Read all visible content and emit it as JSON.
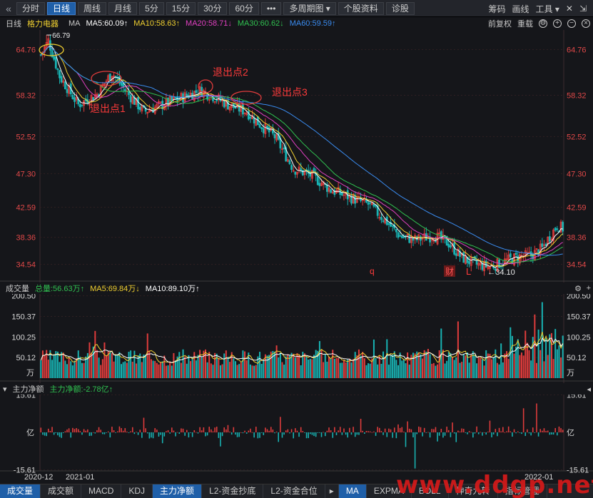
{
  "toolbar": {
    "back_icon": "double-chevron-left-icon",
    "buttons": [
      "分时",
      "日线",
      "周线",
      "月线",
      "5分",
      "15分",
      "30分",
      "60分"
    ],
    "active_index": 1,
    "more_label": "•••",
    "multi_period": "多周期图 ▾",
    "stock_info": "个股资料",
    "diagnose": "诊股",
    "right": [
      "筹码",
      "画线",
      "工具 ▾",
      "✕",
      "⇲"
    ]
  },
  "infobar": {
    "period": "日线",
    "stock_name": "格力电器",
    "indicator": "MA",
    "ma5": "MA5:60.09↑",
    "ma10": "MA10:58.63↑",
    "ma20": "MA20:58.71↓",
    "ma30": "MA30:60.62↓",
    "ma60": "MA60:59.59↑",
    "adjust": "前复权",
    "overlay": "重载"
  },
  "colors": {
    "up": "#e03c3c",
    "down": "#18b3b3",
    "ma5": "#ffffff",
    "ma10": "#f0d030",
    "ma20": "#e040c0",
    "ma30": "#30c050",
    "ma60": "#3a8cf0",
    "axis_red": "#e04848",
    "grid": "#2f1f22"
  },
  "volume_header": {
    "title": "成交量",
    "total": "总量:56.63万↑",
    "ma5": "MA5:69.84万↓",
    "ma10": "MA10:89.10万↑"
  },
  "flow_header": {
    "title": "主力净额",
    "value": "主力净额:-2.78亿↑"
  },
  "tabs": [
    "成交量",
    "成交额",
    "MACD",
    "KDJ",
    "主力净额",
    "L2-资金抄底",
    "L2-资金合位",
    "MA",
    "EXPMA",
    "BOLL",
    "神奇九转",
    "指标管理"
  ],
  "active_tabs": [
    0,
    4,
    7
  ],
  "watermark": "www.ddgp.net",
  "chart_data": [
    {
      "type": "candlestick",
      "y_ticks": [
        "64.76",
        "58.32",
        "52.52",
        "47.30",
        "42.59",
        "38.36",
        "34.54"
      ],
      "ylim": [
        32.5,
        67.5
      ],
      "high_marker": "66.79",
      "low_marker": "←34.10",
      "annotations": [
        "退出点1",
        "退出点2",
        "退出点3"
      ],
      "event_marks": [
        "q",
        "财",
        "L"
      ],
      "x_labels": [
        "2020-12",
        "2021-01",
        "2022-01"
      ],
      "trend_points": [
        [
          0,
          64.0
        ],
        [
          4,
          66.0
        ],
        [
          10,
          61.0
        ],
        [
          20,
          57.0
        ],
        [
          30,
          58.5
        ],
        [
          38,
          61.5
        ],
        [
          45,
          59.0
        ],
        [
          55,
          56.0
        ],
        [
          65,
          57.0
        ],
        [
          75,
          58.0
        ],
        [
          85,
          59.0
        ],
        [
          92,
          58.2
        ],
        [
          100,
          57.0
        ],
        [
          110,
          56.0
        ],
        [
          118,
          54.0
        ],
        [
          125,
          52.5
        ],
        [
          135,
          48.0
        ],
        [
          145,
          47.0
        ],
        [
          155,
          45.0
        ],
        [
          165,
          44.0
        ],
        [
          175,
          43.0
        ],
        [
          185,
          40.5
        ],
        [
          192,
          38.5
        ],
        [
          200,
          38.0
        ],
        [
          210,
          38.6
        ],
        [
          218,
          37.5
        ],
        [
          225,
          35.5
        ],
        [
          232,
          34.6
        ],
        [
          240,
          34.2
        ],
        [
          248,
          35.0
        ],
        [
          255,
          35.6
        ],
        [
          262,
          35.8
        ],
        [
          268,
          36.8
        ],
        [
          272,
          38.5
        ],
        [
          276,
          40.0
        ],
        [
          280,
          39.5
        ]
      ]
    },
    {
      "type": "bar",
      "name": "成交量",
      "y_ticks": [
        "200.50",
        "150.37",
        "100.25",
        "50.12"
      ],
      "unit": "万",
      "ylim": [
        0,
        205
      ]
    },
    {
      "type": "bar",
      "name": "主力净额",
      "y_ticks": [
        "15.61",
        "亿",
        "-15.61"
      ],
      "ylim": [
        -16,
        16
      ]
    }
  ]
}
